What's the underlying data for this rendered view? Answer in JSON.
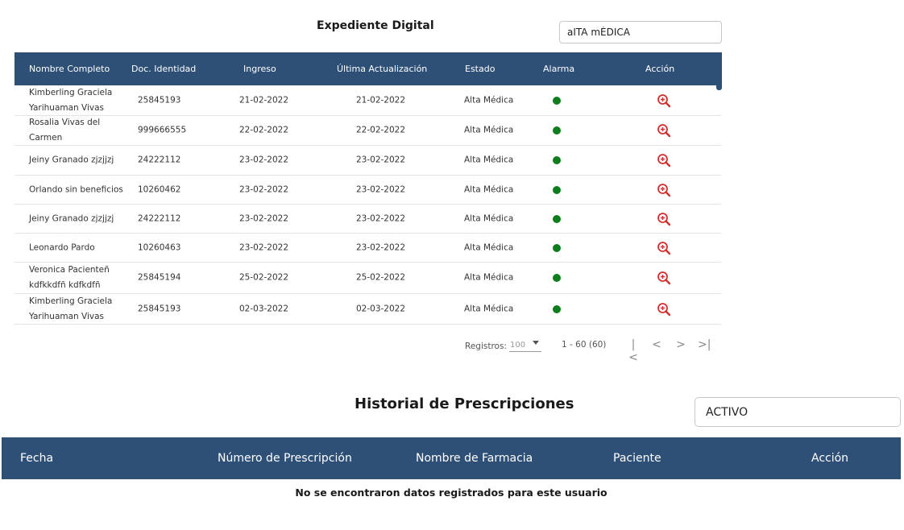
{
  "expediente": {
    "title": "Expediente Digital",
    "search_value": "aITA mÉDICA",
    "columns": [
      "Nombre Completo",
      "Doc. Identidad",
      "Ingreso",
      "Última Actualización",
      "Estado",
      "Alarma",
      "Acción"
    ],
    "rows": [
      {
        "nombre": "Kimberling Graciela Yarihuaman Vivas",
        "doc": "25845193",
        "ingreso": "21-02-2022",
        "actualizacion": "21-02-2022",
        "estado": "Alta Médica",
        "alarma": "green",
        "accion": "zoom-in-icon"
      },
      {
        "nombre": "Rosalia Vivas del Carmen",
        "doc": "999666555",
        "ingreso": "22-02-2022",
        "actualizacion": "22-02-2022",
        "estado": "Alta Médica",
        "alarma": "green",
        "accion": "zoom-in-icon"
      },
      {
        "nombre": "Jeiny Granado zjzjjzj",
        "doc": "24222112",
        "ingreso": "23-02-2022",
        "actualizacion": "23-02-2022",
        "estado": "Alta Médica",
        "alarma": "green",
        "accion": "zoom-in-icon"
      },
      {
        "nombre": "Orlando sin beneficios",
        "doc": "10260462",
        "ingreso": "23-02-2022",
        "actualizacion": "23-02-2022",
        "estado": "Alta Médica",
        "alarma": "green",
        "accion": "zoom-in-icon"
      },
      {
        "nombre": "Jeiny Granado zjzjjzj",
        "doc": "24222112",
        "ingreso": "23-02-2022",
        "actualizacion": "23-02-2022",
        "estado": "Alta Médica",
        "alarma": "green",
        "accion": "zoom-in-icon"
      },
      {
        "nombre": "Leonardo Pardo",
        "doc": "10260463",
        "ingreso": "23-02-2022",
        "actualizacion": "23-02-2022",
        "estado": "Alta Médica",
        "alarma": "green",
        "accion": "zoom-in-icon"
      },
      {
        "nombre": "Veronica Pacienteñ kdfkkdfñ kdfkdfñ",
        "doc": "25845194",
        "ingreso": "25-02-2022",
        "actualizacion": "25-02-2022",
        "estado": "Alta Médica",
        "alarma": "green",
        "accion": "zoom-in-icon"
      },
      {
        "nombre": "Kimberling Graciela Yarihuaman Vivas",
        "doc": "25845193",
        "ingreso": "02-03-2022",
        "actualizacion": "02-03-2022",
        "estado": "Alta Médica",
        "alarma": "green",
        "accion": "zoom-in-icon"
      }
    ],
    "pagination": {
      "registros_label": "Registros:",
      "page_size": "100",
      "range": "1 - 60 (60)",
      "first": "|<",
      "prev": "<",
      "next": ">",
      "last": ">|"
    }
  },
  "historial": {
    "title": "Historial de Prescripciones",
    "search_value": "ACTIVO",
    "columns": [
      "Fecha",
      "Número de Prescripción",
      "Nombre de Farmacia",
      "Paciente",
      "Acción"
    ],
    "empty_message": "No se encontraron datos registrados para este usuario"
  },
  "colors": {
    "header_bg": "#2e5077",
    "alarm_green": "#0e7d1e",
    "action_red": "#d0312d"
  }
}
